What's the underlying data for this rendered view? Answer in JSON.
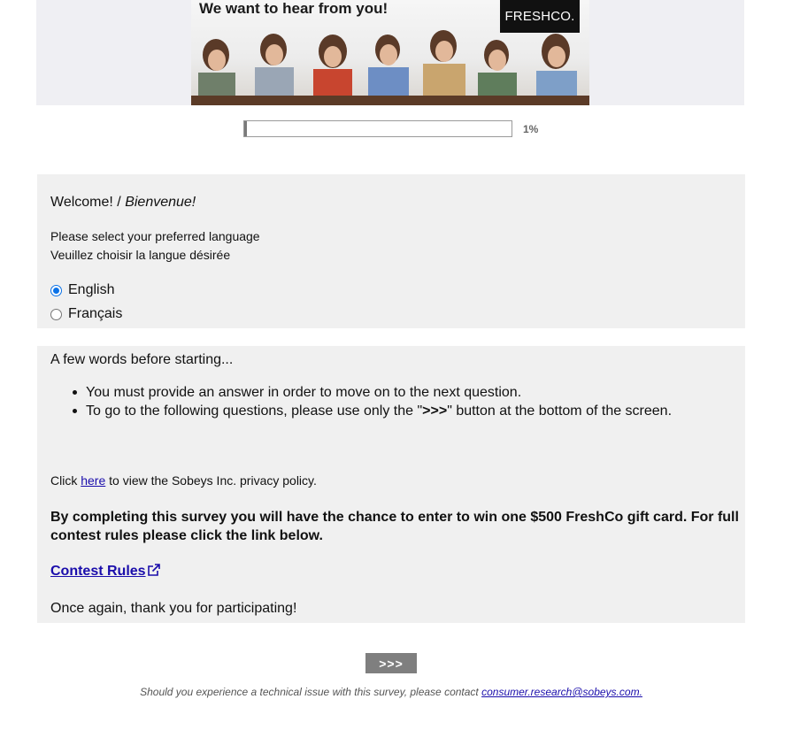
{
  "banner": {
    "headline": "We want to hear from you!",
    "logo": "FRESHCO."
  },
  "progress": {
    "value": 0.01,
    "label": "1%"
  },
  "welcome": {
    "title_en": "Welcome!",
    "separator": " / ",
    "title_fr": "Bienvenue!",
    "prompt_en": "Please select your preferred language",
    "prompt_fr": "Veuillez choisir la langue désirée",
    "options": [
      {
        "label": "English",
        "selected": true
      },
      {
        "label": "Français",
        "selected": false
      }
    ]
  },
  "instructions": {
    "intro": "A few words before starting...",
    "rule_1": "You must provide an answer in order to move on to the next question.",
    "rule_2_before": "To go to the following questions, please use only the \"",
    "rule_2_bold": ">>>",
    "rule_2_after": "\" button at the bottom of the screen.",
    "privacy_before": "Click ",
    "privacy_link": "here",
    "privacy_after": " to view the Sobeys Inc. privacy policy.",
    "contest_text": "By completing this survey you will have the chance to enter to win one $500 FreshCo gift card. For full contest rules please click the link below.",
    "contest_link": "Contest Rules",
    "thanks": "Once again, thank you for participating!"
  },
  "navigation": {
    "next_label": ">>>"
  },
  "footer": {
    "text": "Should you experience a technical issue with this survey, please contact ",
    "email": "consumer.research@sobeys.com."
  },
  "colors": {
    "panel": "#f0f0f0",
    "link": "#1a0dab",
    "radio_accent": "#0b72e7",
    "button": "#7f7f7f"
  }
}
